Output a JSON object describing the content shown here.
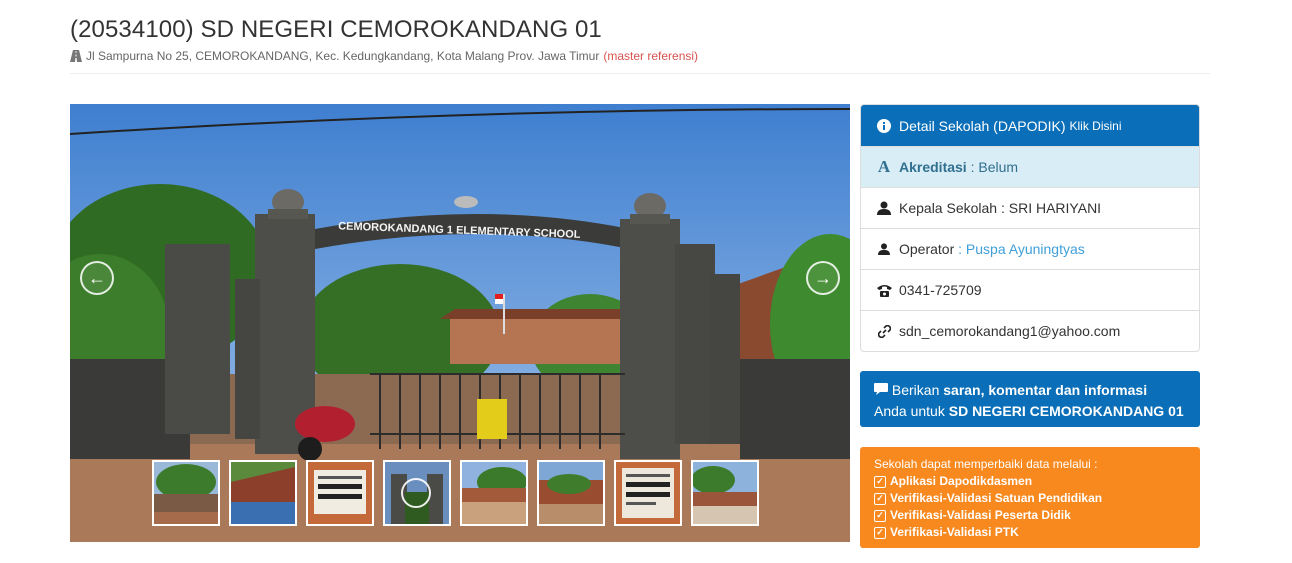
{
  "header": {
    "title": "(20534100) SD NEGERI CEMOROKANDANG 01",
    "address": "Jl Sampurna No 25, CEMOROKANDANG, Kec. Kedungkandang, Kota Malang Prov. Jawa Timur",
    "master_ref": "(master referensi)"
  },
  "gallery": {
    "gate_sign": "CEMOROKANDANG 1 ELEMENTARY SCHOOL",
    "prev_icon": "circle-arrow-left-icon",
    "next_icon": "circle-arrow-right-icon",
    "thumbnail_count": 8
  },
  "info_panel": {
    "detail_label": "Detail Sekolah (DAPODIK)",
    "detail_link": "Klik Disini",
    "akreditasi_label": "Akreditasi",
    "akreditasi_value": "Belum",
    "kepala_label": "Kepala Sekolah",
    "kepala_value": "SRI HARIYANI",
    "operator_label": "Operator",
    "operator_value": "Puspa Ayuningtyas",
    "phone": "0341-725709",
    "email": "sdn_cemorokandang1@yahoo.com",
    "sep": " : "
  },
  "feedback": {
    "prefix": "Berikan",
    "bold_text": "saran, komentar dan informasi",
    "line2_prefix": "Anda untuk",
    "school": "SD NEGERI CEMOROKANDANG 01"
  },
  "repair_box": {
    "intro": "Sekolah dapat memperbaiki data melalui :",
    "links": [
      "Aplikasi Dapodikdasmen",
      "Verifikasi-Validasi Satuan Pendidikan",
      "Verifikasi-Validasi Peserta Didik",
      "Verifikasi-Validasi PTK"
    ]
  },
  "colors": {
    "primary_blue": "#0a6fb8",
    "orange": "#f7891f",
    "akreditasi_bg": "#d9edf7",
    "link_red": "#d9534f"
  }
}
